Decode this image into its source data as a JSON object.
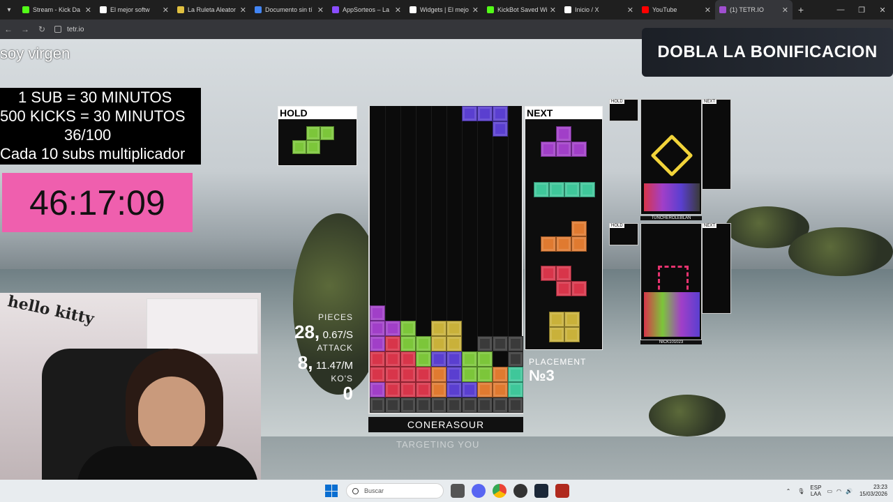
{
  "browser": {
    "tabs": [
      {
        "title": "Stream - Kick Da",
        "color": "#53fc18"
      },
      {
        "title": "El mejor softw",
        "color": "#ffffff"
      },
      {
        "title": "La Ruleta Aleator",
        "color": "#e0c040"
      },
      {
        "title": "Documento sin tí",
        "color": "#4285f4"
      },
      {
        "title": "AppSorteos – La",
        "color": "#8a4dff"
      },
      {
        "title": "Widgets | El mejo",
        "color": "#ffffff"
      },
      {
        "title": "KickBot Saved Wi",
        "color": "#53fc18"
      },
      {
        "title": "Inicio / X",
        "color": "#ffffff"
      },
      {
        "title": "YouTube",
        "color": "#ff0000"
      },
      {
        "title": "(1) TETR.IO",
        "color": "#a04fd0"
      }
    ],
    "url": "tetr.io"
  },
  "overlay": {
    "stream_title": "soy virgen",
    "rules": [
      "1 SUB     = 30 MINUTOS",
      "500 KICKS = 30 MINUTOS",
      "36/100",
      "Cada 10 subs multiplicador"
    ],
    "timer": "46:17:09",
    "banner": "DOBLA LA BONIFICACION"
  },
  "game": {
    "hold_label": "HOLD",
    "next_label": "NEXT",
    "stats": {
      "pieces_label": "PIECES",
      "pieces": "28,",
      "pps": "0.67/S",
      "attack_label": "ATTACK",
      "attack": "8,",
      "apm": "11.47/M",
      "kos_label": "KO'S",
      "kos": "0"
    },
    "placement_label": "PLACEMENT",
    "placement": "№3",
    "username": "CONERASOUR",
    "targeting": "TARGETING YOU",
    "opponents": [
      {
        "name": "TUNCHEROLEBLAN",
        "hold_label": "HOLD",
        "next_label": "NEXT"
      },
      {
        "name": "NICK101023",
        "hold_label": "HOLD",
        "next_label": "NEXT"
      }
    ]
  },
  "webcam": {
    "sign": "hello kitty"
  },
  "taskbar": {
    "search_placeholder": "Buscar",
    "lang": "ESP",
    "lang2": "LAA",
    "time": "23:23",
    "date": "15/03/2026"
  },
  "colors": {
    "purple": "#a13fc8",
    "green": "#7cc63a",
    "red": "#d8354a",
    "orange": "#e07a30",
    "yellow": "#c9b13a",
    "cyan": "#3fc79a",
    "blue": "#5a3fd0",
    "garbage": "#3a3a3a"
  }
}
